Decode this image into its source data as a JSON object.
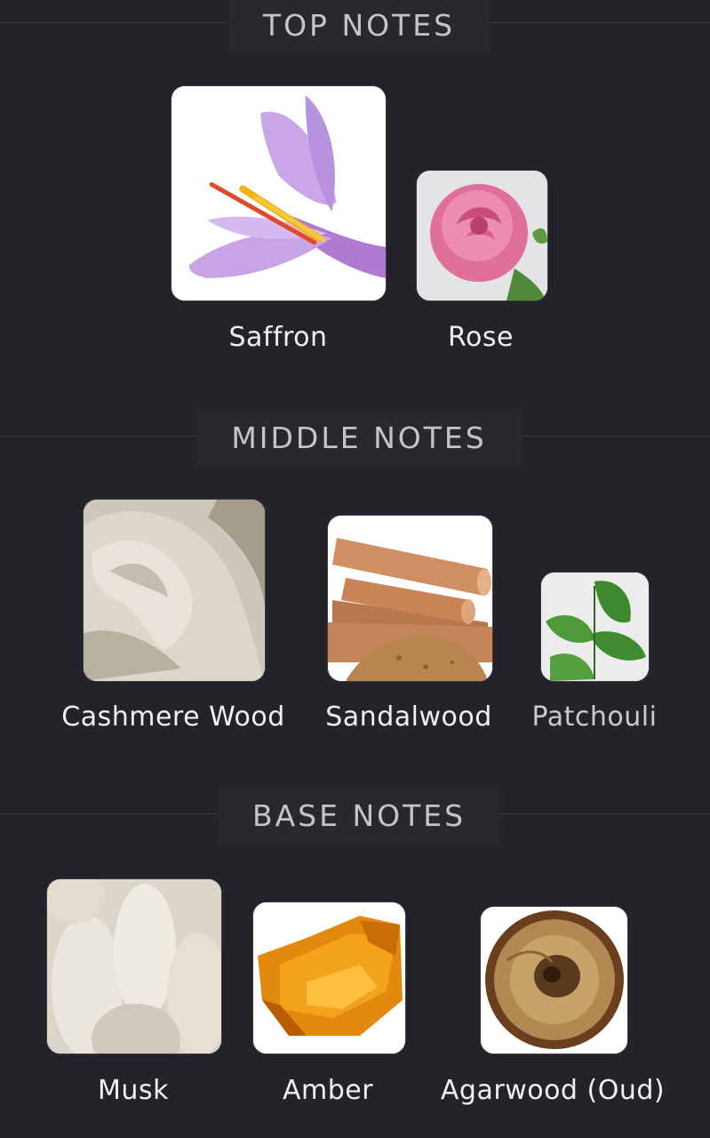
{
  "sections": {
    "top": {
      "title": "TOP NOTES",
      "notes": [
        {
          "label": "Saffron",
          "icon": "saffron-flower-photo"
        },
        {
          "label": "Rose",
          "icon": "rose-photo"
        }
      ]
    },
    "middle": {
      "title": "MIDDLE NOTES",
      "notes": [
        {
          "label": "Cashmere Wood",
          "icon": "cashmere-fabric-photo"
        },
        {
          "label": "Sandalwood",
          "icon": "sandalwood-sticks-photo"
        },
        {
          "label": "Patchouli",
          "icon": "patchouli-leaf-photo"
        }
      ]
    },
    "base": {
      "title": "BASE NOTES",
      "notes": [
        {
          "label": "Musk",
          "icon": "musk-fluff-photo"
        },
        {
          "label": "Amber",
          "icon": "amber-resin-photo"
        },
        {
          "label": "Agarwood (Oud)",
          "icon": "agarwood-slice-photo"
        }
      ]
    }
  },
  "colors": {
    "background": "#23232a",
    "header_text": "#c4c4ca",
    "label_text": "#f0f0f2"
  }
}
